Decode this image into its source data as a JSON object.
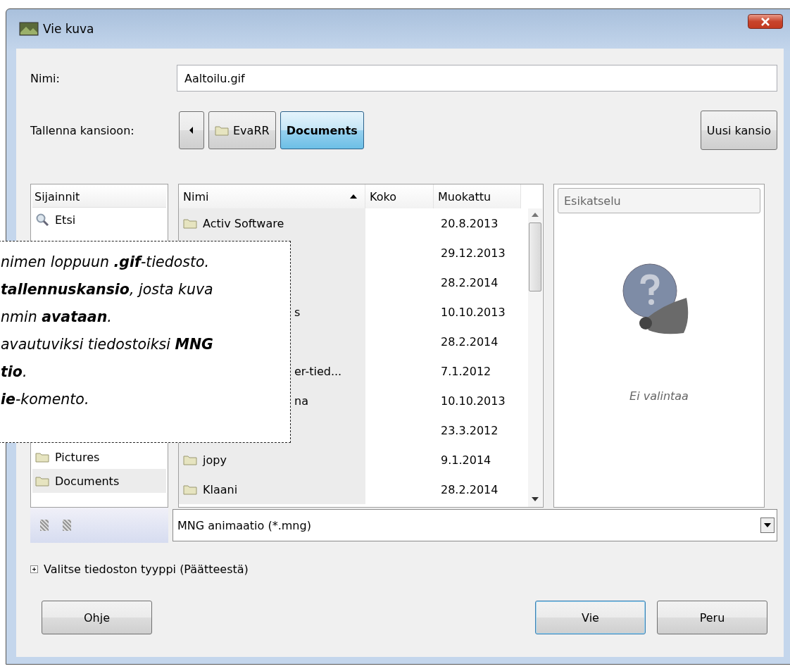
{
  "window": {
    "title": "Vie kuva"
  },
  "name_field": {
    "label": "Nimi:",
    "value": "Aaltoilu.gif"
  },
  "save_folder": {
    "label": "Tallenna kansioon:",
    "path": [
      {
        "label": "EvaRR",
        "selected": false
      },
      {
        "label": "Documents",
        "selected": true
      }
    ],
    "new_folder_button": "Uusi kansio"
  },
  "places": {
    "header": "Sijainnit",
    "items": [
      {
        "label": "Etsi",
        "kind": "search",
        "selected": false
      },
      {
        "label": "Pictures",
        "kind": "folder",
        "selected": false
      },
      {
        "label": "Documents",
        "kind": "folder",
        "selected": true
      }
    ]
  },
  "files": {
    "columns": [
      {
        "label": "Nimi",
        "sorted": true
      },
      {
        "label": "Koko",
        "sorted": false
      },
      {
        "label": "Muokattu",
        "sorted": false
      }
    ],
    "rows": [
      {
        "name": "Activ Software",
        "modified": "20.8.2013",
        "covered": false
      },
      {
        "modified": "29.12.2013"
      },
      {
        "modified": "28.2.2014"
      },
      {
        "name": "s",
        "modified": "10.10.2013",
        "covered": true
      },
      {
        "modified": "28.2.2014"
      },
      {
        "name": "er-tied...",
        "modified": "7.1.2012",
        "covered": true
      },
      {
        "name": "na",
        "modified": "10.10.2013",
        "covered": true
      },
      {
        "modified": "23.3.2012"
      },
      {
        "name": "jopy",
        "modified": "9.1.2014",
        "covered": false
      },
      {
        "name": "Klaani",
        "modified": "28.2.2014",
        "covered": false
      }
    ]
  },
  "preview": {
    "header": "Esikatselu",
    "message": "Ei valintaa"
  },
  "filter": {
    "value": "MNG animaatio (*.mng)"
  },
  "expander": {
    "label": "Valitse tiedoston tyyppi (Päätteestä)",
    "expanded": false
  },
  "buttons": [
    {
      "label": "Ohje",
      "default": false
    },
    {
      "label": "Vie",
      "default": true
    },
    {
      "label": "Peru",
      "default": false
    }
  ],
  "callout": {
    "lines": [
      "nimen loppuun **.gif**-tiedosto.",
      "**tallennuskansio**, josta kuva",
      "nmin **avataan**.",
      "avautuviksi tiedostoiksi **MNG**",
      "**tio**.",
      "**ie**-komento."
    ]
  }
}
